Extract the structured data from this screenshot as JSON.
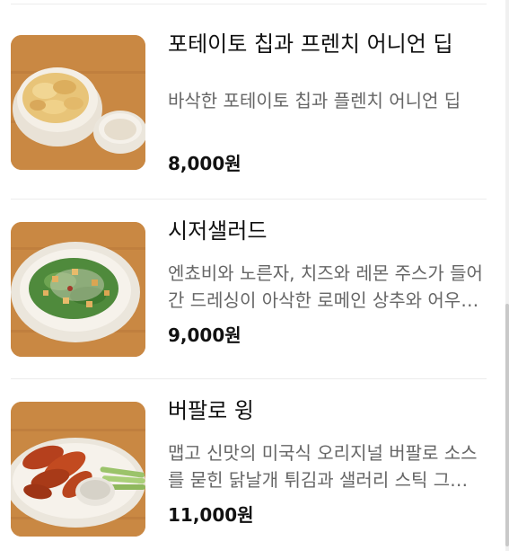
{
  "menu_items": [
    {
      "name": "포테이토 칩과 프렌치 어니언 딥",
      "description": "바삭한 포테이토 칩과 플렌치 어니언 딥",
      "price": "8,000원"
    },
    {
      "name": "시저샐러드",
      "description": "엔쵸비와 노른자, 치즈와 레몬 주스가 들어간 드레싱이 아삭한 로메인 상추와 어우러진 샐러드",
      "price": "9,000원"
    },
    {
      "name": "버팔로 윙",
      "description": "맵고 신맛의 미국식 오리지널 버팔로 소스를 묻힌 닭날개 튀김과 샐러리 스틱 그리고 블루치즈 드레싱",
      "price": "11,000원"
    }
  ]
}
